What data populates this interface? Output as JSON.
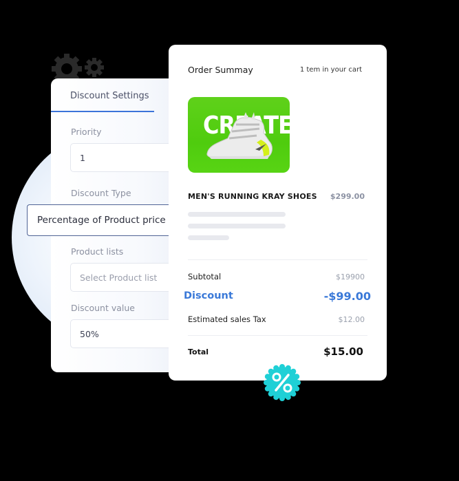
{
  "colors": {
    "accent_blue": "#3a79d8",
    "badge_teal": "#1fd0d6",
    "product_green": "#5cd115"
  },
  "settings": {
    "tab_label": "Discount Settings",
    "fields": [
      {
        "label": "Priority",
        "value": "1"
      },
      {
        "label": "Discount Type",
        "value": "Percentage of Product price"
      },
      {
        "label": "Product lists",
        "placeholder": "Select Product list"
      },
      {
        "label": "Discount value",
        "value": "50%"
      }
    ]
  },
  "order": {
    "title": "Order Summay",
    "cart_count": "1 tem in your cart",
    "product_image_text": "CREATE",
    "product_name": "MEN'S RUNNING KRAY SHOES",
    "product_price": "$299.00",
    "subtotal_label": "Subtotal",
    "subtotal_value": "$19900",
    "discount_label": "Discount",
    "discount_value": "-$99.00",
    "tax_label": "Estimated sales Tax",
    "tax_value": "$12.00",
    "total_label": "Total",
    "total_value": "$15.00"
  },
  "icons": {
    "gears": "gears-icon",
    "badge": "percent-badge-icon"
  }
}
